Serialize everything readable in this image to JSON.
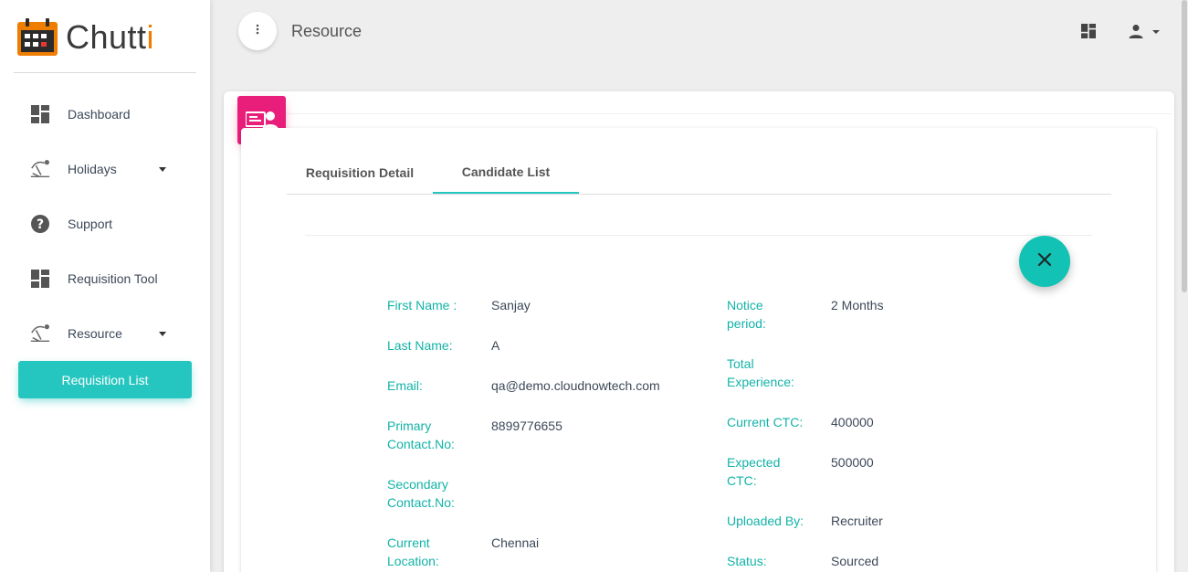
{
  "brand": {
    "name_main": "Chutt",
    "name_accent": "i"
  },
  "sidebar": {
    "items": [
      {
        "label": "Dashboard",
        "icon": "dashboard-icon"
      },
      {
        "label": "Holidays",
        "icon": "beach-icon"
      },
      {
        "label": "Support",
        "icon": "help-icon"
      },
      {
        "label": "Requisition Tool",
        "icon": "dashboard-icon"
      },
      {
        "label": "Resource",
        "icon": "beach-icon"
      }
    ],
    "sub_item": "Requisition List"
  },
  "header": {
    "title": "Resource"
  },
  "tabs": [
    {
      "label": "Requisition Detail"
    },
    {
      "label": "Candidate List"
    }
  ],
  "candidate": {
    "left": [
      {
        "label": "First Name :",
        "value": "Sanjay"
      },
      {
        "label": "Last Name:",
        "value": "A"
      },
      {
        "label": "Email:",
        "value": "qa@demo.cloudnowtech.com"
      },
      {
        "label": "Primary Contact.No:",
        "value": "8899776655"
      },
      {
        "label": "Secondary Contact.No:",
        "value": ""
      },
      {
        "label": "Current Location:",
        "value": "Chennai"
      }
    ],
    "right": [
      {
        "label": "Notice period:",
        "value": "2 Months"
      },
      {
        "label": "Total Experience:",
        "value": ""
      },
      {
        "label": "Current CTC:",
        "value": "400000"
      },
      {
        "label": "Expected CTC:",
        "value": "500000"
      },
      {
        "label": "Uploaded By:",
        "value": "Recruiter"
      },
      {
        "label": "Status:",
        "value": "Sourced"
      }
    ]
  },
  "colors": {
    "accent": "#26c6c0",
    "label": "#12b3a8",
    "card_icon": "#e91e7b",
    "brand": "#ef7d00"
  }
}
